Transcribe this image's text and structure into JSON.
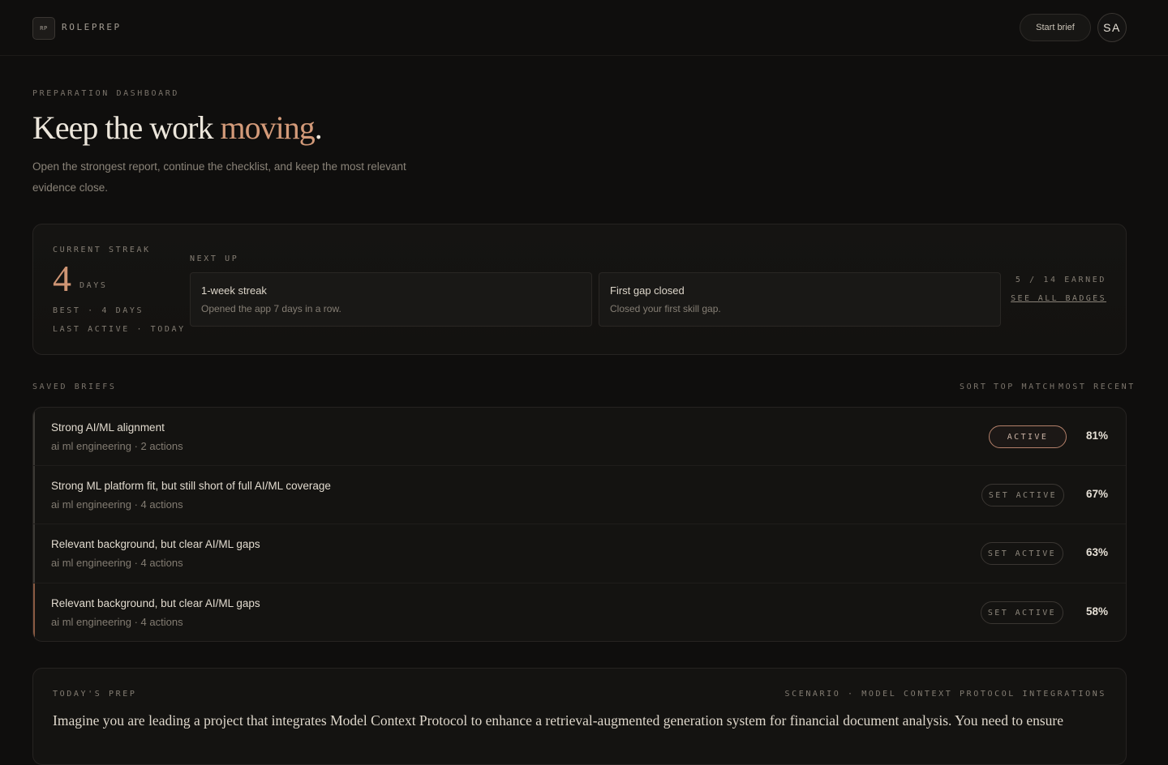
{
  "header": {
    "logo_text": "RP",
    "brand": "ROLEPREP",
    "start_brief": "Start brief",
    "avatar": "SA"
  },
  "hero": {
    "eyebrow": "PREPARATION DASHBOARD",
    "title_main": "Keep the work ",
    "title_accent": "moving",
    "title_end": ".",
    "subtitle": "Open the strongest report, continue the checklist, and keep the most relevant evidence close."
  },
  "streak": {
    "label": "CURRENT STREAK",
    "count": "4",
    "unit": "DAYS",
    "best": "BEST · 4 DAYS",
    "last_active": "LAST ACTIVE · TODAY",
    "next_up_label": "NEXT UP",
    "badges": [
      {
        "title": "1-week streak",
        "desc": "Opened the app 7 days in a row."
      },
      {
        "title": "First gap closed",
        "desc": "Closed your first skill gap."
      }
    ],
    "earned": "5 / 14 EARNED",
    "see_all": "SEE ALL BADGES"
  },
  "saved_briefs": {
    "label": "SAVED BRIEFS",
    "sort_label": "SORT",
    "sort_options": [
      "TOP MATCH",
      "MOST RECENT"
    ],
    "items": [
      {
        "title": "Strong AI/ML alignment",
        "meta": "ai ml engineering · 2 actions",
        "action": "ACTIVE",
        "pct": "81%"
      },
      {
        "title": "Strong ML platform fit, but still short of full AI/ML coverage",
        "meta": "ai ml engineering · 4 actions",
        "action": "SET ACTIVE",
        "pct": "67%"
      },
      {
        "title": "Relevant background, but clear AI/ML gaps",
        "meta": "ai ml engineering · 4 actions",
        "action": "SET ACTIVE",
        "pct": "63%"
      },
      {
        "title": "Relevant background, but clear AI/ML gaps",
        "meta": "ai ml engineering · 4 actions",
        "action": "SET ACTIVE",
        "pct": "58%"
      }
    ]
  },
  "todays_prep": {
    "label": "TODAY'S PREP",
    "scenario": "SCENARIO · MODEL CONTEXT PROTOCOL INTEGRATIONS",
    "text": "Imagine you are leading a project that integrates Model Context Protocol to enhance a retrieval-augmented generation system for financial document analysis. You need to ensure"
  },
  "colors": {
    "background": "#0f0e0d",
    "accent": "#d39a79",
    "text": "#e6e0d6"
  }
}
